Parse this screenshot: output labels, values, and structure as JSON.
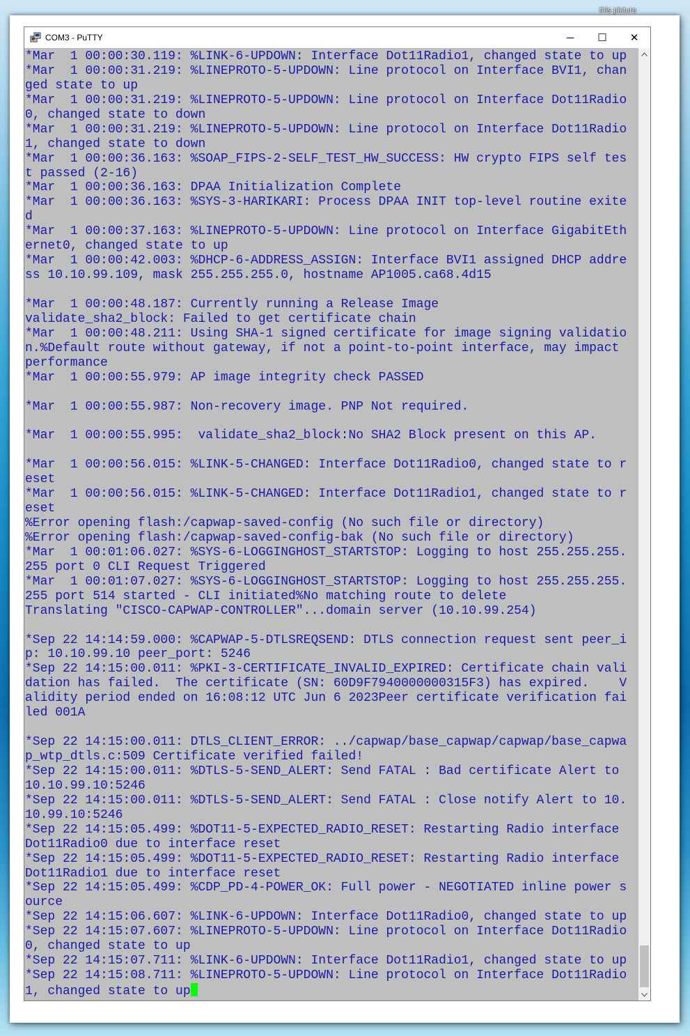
{
  "caption": "this picture",
  "window": {
    "title": "COM3 - PuTTY",
    "minimize": "─",
    "maximize": "☐",
    "close": "✕"
  },
  "icons": {
    "app": "putty-icon",
    "scroll_up": "chevron-up-icon",
    "scroll_down": "chevron-down-icon"
  },
  "terminal": {
    "text_color": "#1a1aa8",
    "background": "#bfbfbf",
    "cursor_color": "#00ff00",
    "lines": [
      "*Mar  1 00:00:30.119: %LINK-6-UPDOWN: Interface Dot11Radio1, changed state to up",
      "*Mar  1 00:00:31.219: %LINEPROTO-5-UPDOWN: Line protocol on Interface BVI1, chan",
      "ged state to up",
      "*Mar  1 00:00:31.219: %LINEPROTO-5-UPDOWN: Line protocol on Interface Dot11Radio",
      "0, changed state to down",
      "*Mar  1 00:00:31.219: %LINEPROTO-5-UPDOWN: Line protocol on Interface Dot11Radio",
      "1, changed state to down",
      "*Mar  1 00:00:36.163: %SOAP_FIPS-2-SELF_TEST_HW_SUCCESS: HW crypto FIPS self tes",
      "t passed (2-16)",
      "*Mar  1 00:00:36.163: DPAA Initialization Complete",
      "*Mar  1 00:00:36.163: %SYS-3-HARIKARI: Process DPAA INIT top-level routine exite",
      "d",
      "*Mar  1 00:00:37.163: %LINEPROTO-5-UPDOWN: Line protocol on Interface GigabitEth",
      "ernet0, changed state to up",
      "*Mar  1 00:00:42.003: %DHCP-6-ADDRESS_ASSIGN: Interface BVI1 assigned DHCP addre",
      "ss 10.10.99.109, mask 255.255.255.0, hostname AP1005.ca68.4d15",
      "",
      "*Mar  1 00:00:48.187: Currently running a Release Image",
      "validate_sha2_block: Failed to get certificate chain",
      "*Mar  1 00:00:48.211: Using SHA-1 signed certificate for image signing validatio",
      "n.%Default route without gateway, if not a point-to-point interface, may impact",
      "performance",
      "*Mar  1 00:00:55.979: AP image integrity check PASSED",
      "",
      "*Mar  1 00:00:55.987: Non-recovery image. PNP Not required.",
      "",
      "*Mar  1 00:00:55.995:  validate_sha2_block:No SHA2 Block present on this AP.",
      "",
      "*Mar  1 00:00:56.015: %LINK-5-CHANGED: Interface Dot11Radio0, changed state to r",
      "eset",
      "*Mar  1 00:00:56.015: %LINK-5-CHANGED: Interface Dot11Radio1, changed state to r",
      "eset",
      "%Error opening flash:/capwap-saved-config (No such file or directory)",
      "%Error opening flash:/capwap-saved-config-bak (No such file or directory)",
      "*Mar  1 00:01:06.027: %SYS-6-LOGGINGHOST_STARTSTOP: Logging to host 255.255.255.",
      "255 port 0 CLI Request Triggered",
      "*Mar  1 00:01:07.027: %SYS-6-LOGGINGHOST_STARTSTOP: Logging to host 255.255.255.",
      "255 port 514 started - CLI initiated%No matching route to delete",
      "Translating \"CISCO-CAPWAP-CONTROLLER\"...domain server (10.10.99.254)",
      "",
      "*Sep 22 14:14:59.000: %CAPWAP-5-DTLSREQSEND: DTLS connection request sent peer_i",
      "p: 10.10.99.10 peer_port: 5246",
      "*Sep 22 14:15:00.011: %PKI-3-CERTIFICATE_INVALID_EXPIRED: Certificate chain vali",
      "dation has failed.  The certificate (SN: 60D9F7940000000315F3) has expired.    V",
      "alidity period ended on 16:08:12 UTC Jun 6 2023Peer certificate verification fai",
      "led 001A",
      "",
      "*Sep 22 14:15:00.011: DTLS_CLIENT_ERROR: ../capwap/base_capwap/capwap/base_capwa",
      "p_wtp_dtls.c:509 Certificate verified failed!",
      "*Sep 22 14:15:00.011: %DTLS-5-SEND_ALERT: Send FATAL : Bad certificate Alert to",
      "10.10.99.10:5246",
      "*Sep 22 14:15:00.011: %DTLS-5-SEND_ALERT: Send FATAL : Close notify Alert to 10.",
      "10.99.10:5246",
      "*Sep 22 14:15:05.499: %DOT11-5-EXPECTED_RADIO_RESET: Restarting Radio interface",
      "Dot11Radio0 due to interface reset",
      "*Sep 22 14:15:05.499: %DOT11-5-EXPECTED_RADIO_RESET: Restarting Radio interface",
      "Dot11Radio1 due to interface reset",
      "*Sep 22 14:15:05.499: %CDP_PD-4-POWER_OK: Full power - NEGOTIATED inline power s",
      "ource",
      "*Sep 22 14:15:06.607: %LINK-6-UPDOWN: Interface Dot11Radio0, changed state to up",
      "*Sep 22 14:15:07.607: %LINEPROTO-5-UPDOWN: Line protocol on Interface Dot11Radio",
      "0, changed state to up",
      "*Sep 22 14:15:07.711: %LINK-6-UPDOWN: Interface Dot11Radio1, changed state to up",
      "*Sep 22 14:15:08.711: %LINEPROTO-5-UPDOWN: Line protocol on Interface Dot11Radio",
      "1, changed state to up"
    ]
  }
}
